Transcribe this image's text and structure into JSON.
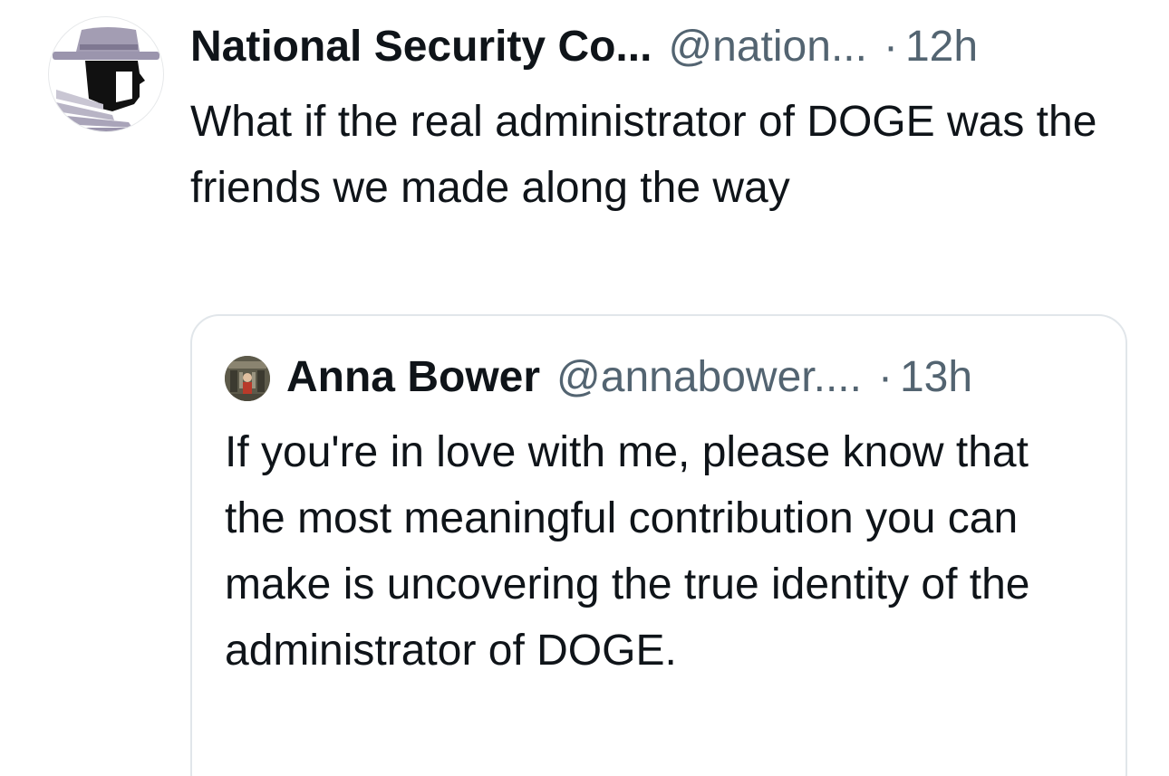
{
  "post": {
    "author_name": "National Security Co...",
    "author_handle": "@nation...",
    "separator": "·",
    "timestamp": "12h",
    "text": "What if the real administrator of DOGE was the friends we made along the way",
    "avatar_icon": "detective-hat-logo-icon"
  },
  "quoted_post": {
    "author_name": "Anna Bower",
    "author_handle": "@annabower....",
    "separator": "·",
    "timestamp": "13h",
    "text": "If you're in love with me, please know that the most meaningful contribution you can make is uncovering the true identity of the administrator of DOGE.",
    "avatar_icon": "profile-photo-icon"
  },
  "colors": {
    "primary_text": "#0f1419",
    "secondary_text": "#536471",
    "card_border": "#e1e6ea",
    "hat_purple": "#9b95ad"
  }
}
